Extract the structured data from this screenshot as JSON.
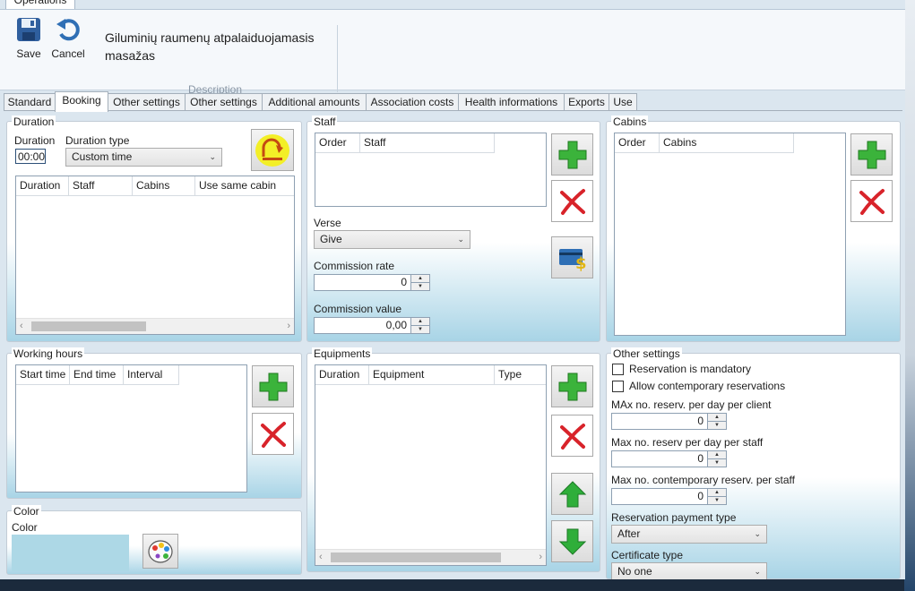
{
  "ribbon": {
    "tab_label": "Operations",
    "save_label": "Save",
    "cancel_label": "Cancel",
    "description_text": "Giluminių raumenų atpalaiduojamasis masažas",
    "description_group": "Description"
  },
  "tabs": [
    "Standard",
    "Booking",
    "Other settings",
    "Other settings",
    "Additional amounts",
    "Association costs",
    "Health informations",
    "Exports",
    "Use"
  ],
  "active_tab": "Booking",
  "duration": {
    "title": "Duration",
    "duration_label": "Duration",
    "duration_value": "00:00",
    "type_label": "Duration type",
    "type_value": "Custom time",
    "columns": [
      "Duration",
      "Staff",
      "Cabins",
      "Use same cabin"
    ]
  },
  "staff": {
    "title": "Staff",
    "columns": [
      "Order",
      "Staff"
    ],
    "verse_label": "Verse",
    "verse_value": "Give",
    "commission_rate_label": "Commission rate",
    "commission_rate_value": "0",
    "commission_value_label": "Commission value",
    "commission_value_value": "0,00"
  },
  "cabins": {
    "title": "Cabins",
    "columns": [
      "Order",
      "Cabins"
    ]
  },
  "working_hours": {
    "title": "Working hours",
    "columns": [
      "Start time",
      "End time",
      "Interval"
    ]
  },
  "equipments": {
    "title": "Equipments",
    "columns": [
      "Duration",
      "Equipment",
      "Type"
    ]
  },
  "color": {
    "title": "Color",
    "label": "Color",
    "swatch": "#add8e6"
  },
  "other_settings": {
    "title": "Other settings",
    "mandatory_label": "Reservation is mandatory",
    "contemporary_label": "Allow contemporary reservations",
    "max_client_label": "MAx no. reserv. per day per client",
    "max_client_value": "0",
    "max_staff_label": "Max no. reserv per day per staff",
    "max_staff_value": "0",
    "max_contemporary_label": "Max no. contemporary reserv. per staff",
    "max_contemporary_value": "0",
    "payment_type_label": "Reservation payment type",
    "payment_type_value": "After",
    "certificate_type_label": "Certificate type",
    "certificate_type_value": "No one"
  },
  "icons": {
    "add": "green-plus-icon",
    "delete": "red-x-icon",
    "up": "green-up-arrow-icon",
    "down": "green-down-arrow-icon",
    "payment": "credit-card-dollar-icon",
    "palette": "palette-icon",
    "reset": "reset-icon",
    "save": "floppy-disk-icon",
    "cancel": "undo-arrow-icon"
  }
}
